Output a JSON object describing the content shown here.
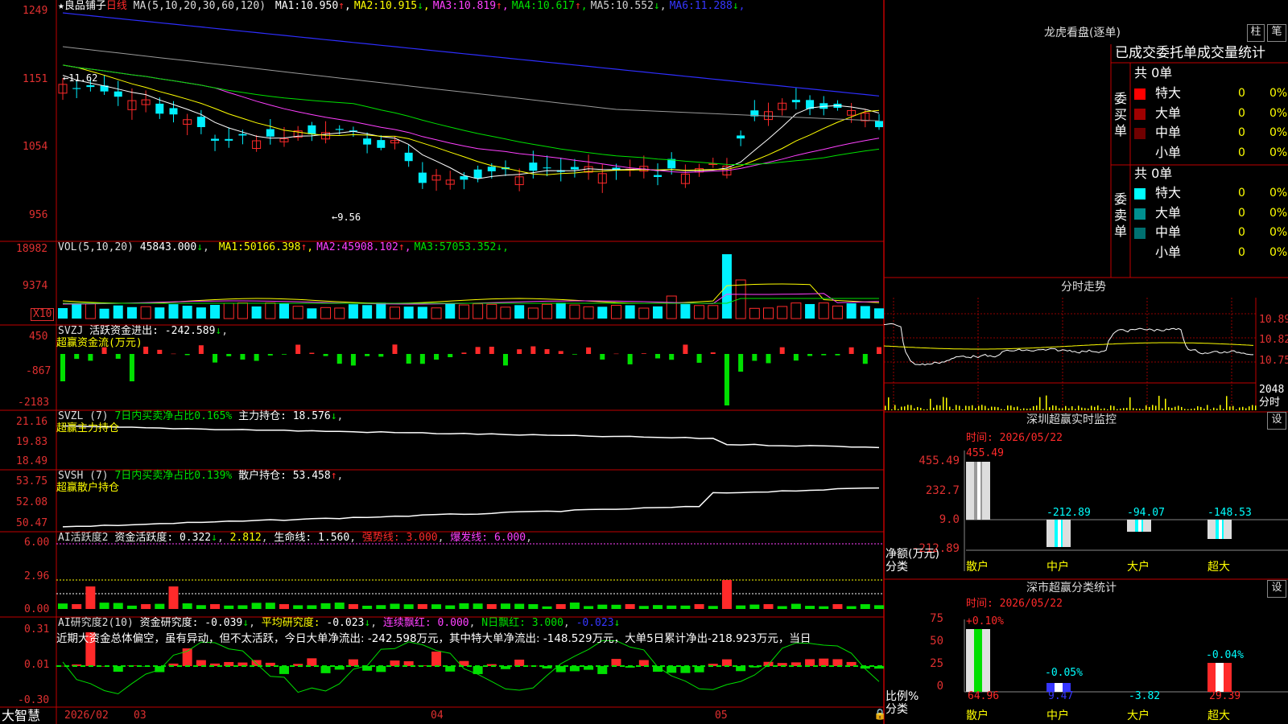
{
  "stock": {
    "name": "★良品铺子",
    "period": "日线"
  },
  "colors": {
    "up": "#ff2a2a",
    "down": "#00f0ff",
    "grid": "#c00000",
    "white": "#ffffff",
    "yellow": "#ffff00",
    "magenta": "#ff40ff",
    "green": "#00e000",
    "gray": "#9a9a9a",
    "blue": "#2e2efe"
  },
  "k": {
    "ma_label": "MA(5,10,20,30,60,120)",
    "ma": [
      {
        "name": "MA1:",
        "value": "10.950",
        "arrow": "↑",
        "color": "#ffffff"
      },
      {
        "name": "MA2:",
        "value": "10.915",
        "arrow": "↓",
        "color": "#ffff00"
      },
      {
        "name": "MA3:",
        "value": "10.819",
        "arrow": "↑",
        "color": "#ff40ff"
      },
      {
        "name": "MA4:",
        "value": "10.617",
        "arrow": "↑",
        "color": "#00e000"
      },
      {
        "name": "MA5:",
        "value": "10.552",
        "arrow": "↓",
        "color": "#cfcfcf"
      },
      {
        "name": "MA6:",
        "value": "11.288",
        "arrow": "↓",
        "color": "#3636ff"
      }
    ],
    "axis": [
      "1249",
      "1151",
      "1054",
      "956"
    ],
    "high_mark": "←11.62",
    "low_mark": "←9.56"
  },
  "vol": {
    "label": "VOL(5,10,20)",
    "value": "45843.000",
    "arrow": "↓",
    "ma": [
      {
        "name": "MA1:",
        "value": "50166.398",
        "arrow": "↑",
        "color": "#ffff00"
      },
      {
        "name": "MA2:",
        "value": "45908.102",
        "arrow": "↑",
        "color": "#ff40ff"
      },
      {
        "name": "MA3:",
        "value": "57053.352",
        "arrow": "↓",
        "color": "#00e000"
      }
    ],
    "axis": [
      "18982",
      "9374"
    ],
    "unit": "X10"
  },
  "svzj": {
    "label": "SVZJ",
    "title": "活跃资金进出:",
    "value": "-242.589",
    "arrow": "↓",
    "sub": "超赢资金流(万元)",
    "axis": [
      "450",
      "-867",
      "-2183"
    ]
  },
  "svzl": {
    "label": "SVZL (7)",
    "title": "7日内买卖净占比0.165%",
    "hold": "主力持仓:",
    "value": "18.576",
    "arrow": "↓",
    "sub": "超赢主力持仓",
    "axis": [
      "21.16",
      "19.83",
      "18.49"
    ]
  },
  "svsh": {
    "label": "SVSH (7)",
    "title": "7日内买卖净占比0.139%",
    "hold": "散户持仓:",
    "value": "53.458",
    "arrow": "↑",
    "sub": "超赢散户持仓",
    "axis": [
      "53.75",
      "52.08",
      "50.47"
    ]
  },
  "ai1": {
    "label": "AI活跃度2",
    "title": "资金活跃度:",
    "v1": "0.322",
    "v2": "2.812",
    "life": "生命线:",
    "v3": "1.560",
    "strong": "强势线: 3.000",
    "burst": "爆发线: 6.000",
    "axis": [
      "6.00",
      "2.96",
      "0.00"
    ]
  },
  "ai2": {
    "label": "AI研究度2(10)",
    "title": "资金研究度:",
    "v1": "-0.039",
    "avg": "平均研究度:",
    "v2": "-0.023",
    "red1": "连续飘红: 0.000",
    "red2": "N日飘红: 3.000",
    "v3": "-0.023",
    "comment": "近期大资金总体偏空，虽有异动，但不太活跃，今日大单净流出: -242.598万元，其中特大单净流出: -148.529万元，大单5日累计净出-218.923万元，当日",
    "axis": [
      "0.31",
      "0.01",
      "-0.30"
    ]
  },
  "time_axis": {
    "brand": "大智慧",
    "labels": [
      "2026/02",
      "03",
      "04",
      "05"
    ]
  },
  "dragon": {
    "title": "龙虎看盘(逐单)",
    "btn1": "柱",
    "btn2": "笔",
    "heading": "已成交委托单成交量统计",
    "buy": {
      "label": "委买单",
      "total": "共 0单",
      "rows": [
        {
          "name": "特大",
          "n": "0",
          "p": "0%",
          "color": "#ff0000"
        },
        {
          "name": "大单",
          "n": "0",
          "p": "0%",
          "color": "#a00000"
        },
        {
          "name": "中单",
          "n": "0",
          "p": "0%",
          "color": "#700000"
        },
        {
          "name": "小单",
          "n": "0",
          "p": "0%",
          "color": "#000000"
        }
      ]
    },
    "sell": {
      "label": "委卖单",
      "total": "共 0单",
      "rows": [
        {
          "name": "特大",
          "n": "0",
          "p": "0%",
          "color": "#00ffff"
        },
        {
          "name": "大单",
          "n": "0",
          "p": "0%",
          "color": "#008f8f"
        },
        {
          "name": "中单",
          "n": "0",
          "p": "0%",
          "color": "#007070"
        },
        {
          "name": "小单",
          "n": "0",
          "p": "0%",
          "color": "#000000"
        }
      ]
    }
  },
  "intraday": {
    "title": "分时走势",
    "axis": [
      "10.89",
      "10.82",
      "10.75"
    ],
    "vol": "2048",
    "vol_unit": "分时"
  },
  "monitor": {
    "title": "深圳超赢实时监控",
    "btn": "设",
    "time": "时间: 2026/05/22",
    "axis": [
      "455.49",
      "232.7",
      "9.0",
      "-212.89"
    ],
    "label1": "净额(万元)",
    "label2": "分类",
    "values": [
      "455.49",
      "-212.89",
      "-94.07",
      "-148.53"
    ],
    "cats": [
      "散户",
      "中户",
      "大户",
      "超大"
    ]
  },
  "classify": {
    "title": "深市超赢分类统计",
    "btn": "设",
    "time": "时间: 2026/05/22",
    "axis": [
      "75",
      "50",
      "25",
      "0"
    ],
    "label1": "比例%",
    "label2": "分类",
    "top": [
      "+0.10%",
      "-0.05%",
      "",
      "-0.04%"
    ],
    "values": [
      "64.96",
      "9.47",
      "-3.82",
      "29.39"
    ],
    "cats": [
      "散户",
      "中户",
      "大户",
      "超大"
    ]
  }
}
